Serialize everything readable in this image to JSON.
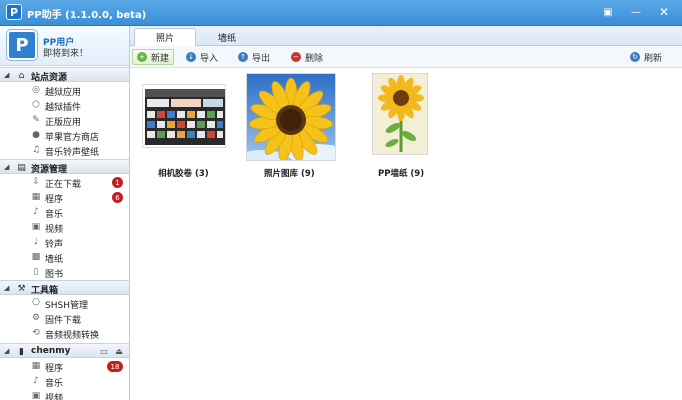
{
  "window": {
    "title": "PP助手 (1.1.0.0, beta)",
    "controls": {
      "menu_icon": "menu-icon",
      "minimize_icon": "minimize-icon",
      "close_icon": "close-icon"
    }
  },
  "user": {
    "name": "PP用户",
    "welcome": "即将到来！"
  },
  "sidebar": {
    "groups": [
      {
        "label": "站点资源",
        "icon": "home-icon",
        "items": [
          {
            "label": "越狱应用",
            "icon": "apps-icon"
          },
          {
            "label": "越狱插件",
            "icon": "plugin-icon"
          },
          {
            "label": "正版应用",
            "icon": "store-icon"
          },
          {
            "label": "苹果官方商店",
            "icon": "apple-icon"
          },
          {
            "label": "音乐铃声壁纸",
            "icon": "music-icon"
          }
        ]
      },
      {
        "label": "资源管理",
        "icon": "folder-icon",
        "items": [
          {
            "label": "正在下载",
            "icon": "download-icon",
            "badge": "1"
          },
          {
            "label": "程序",
            "icon": "program-icon",
            "badge": "6"
          },
          {
            "label": "音乐",
            "icon": "music-icon"
          },
          {
            "label": "视频",
            "icon": "video-icon"
          },
          {
            "label": "铃声",
            "icon": "ringtone-icon"
          },
          {
            "label": "墙纸",
            "icon": "wallpaper-icon"
          },
          {
            "label": "图书",
            "icon": "book-icon"
          }
        ]
      },
      {
        "label": "工具箱",
        "icon": "toolbox-icon",
        "items": [
          {
            "label": "SHSH管理",
            "icon": "shsh-icon"
          },
          {
            "label": "固件下载",
            "icon": "firmware-icon"
          },
          {
            "label": "音频视频转换",
            "icon": "convert-icon"
          }
        ]
      },
      {
        "label": "chenmy",
        "icon": "device-icon",
        "items": [
          {
            "label": "程序",
            "icon": "program-icon",
            "badge": "18"
          },
          {
            "label": "音乐",
            "icon": "music-icon"
          },
          {
            "label": "视频",
            "icon": "video-icon"
          }
        ]
      }
    ]
  },
  "tabs": [
    {
      "label": "照片",
      "active": true
    },
    {
      "label": "墙纸",
      "active": false
    }
  ],
  "toolbar": {
    "new": "新建",
    "import": "导入",
    "export": "导出",
    "delete": "删除",
    "refresh": "刷新"
  },
  "albums": [
    {
      "label": "相机胶卷 (3)",
      "icon": "camera-roll-thumbnail"
    },
    {
      "label": "照片图库 (9)",
      "icon": "sunflower-thumbnail"
    },
    {
      "label": "PP墙纸 (9)",
      "icon": "sunflower-vase-thumbnail"
    }
  ],
  "colors": {
    "titlebar": "#3b8dd6",
    "badge": "#c41e1e",
    "accent": "#1b6bc4"
  }
}
